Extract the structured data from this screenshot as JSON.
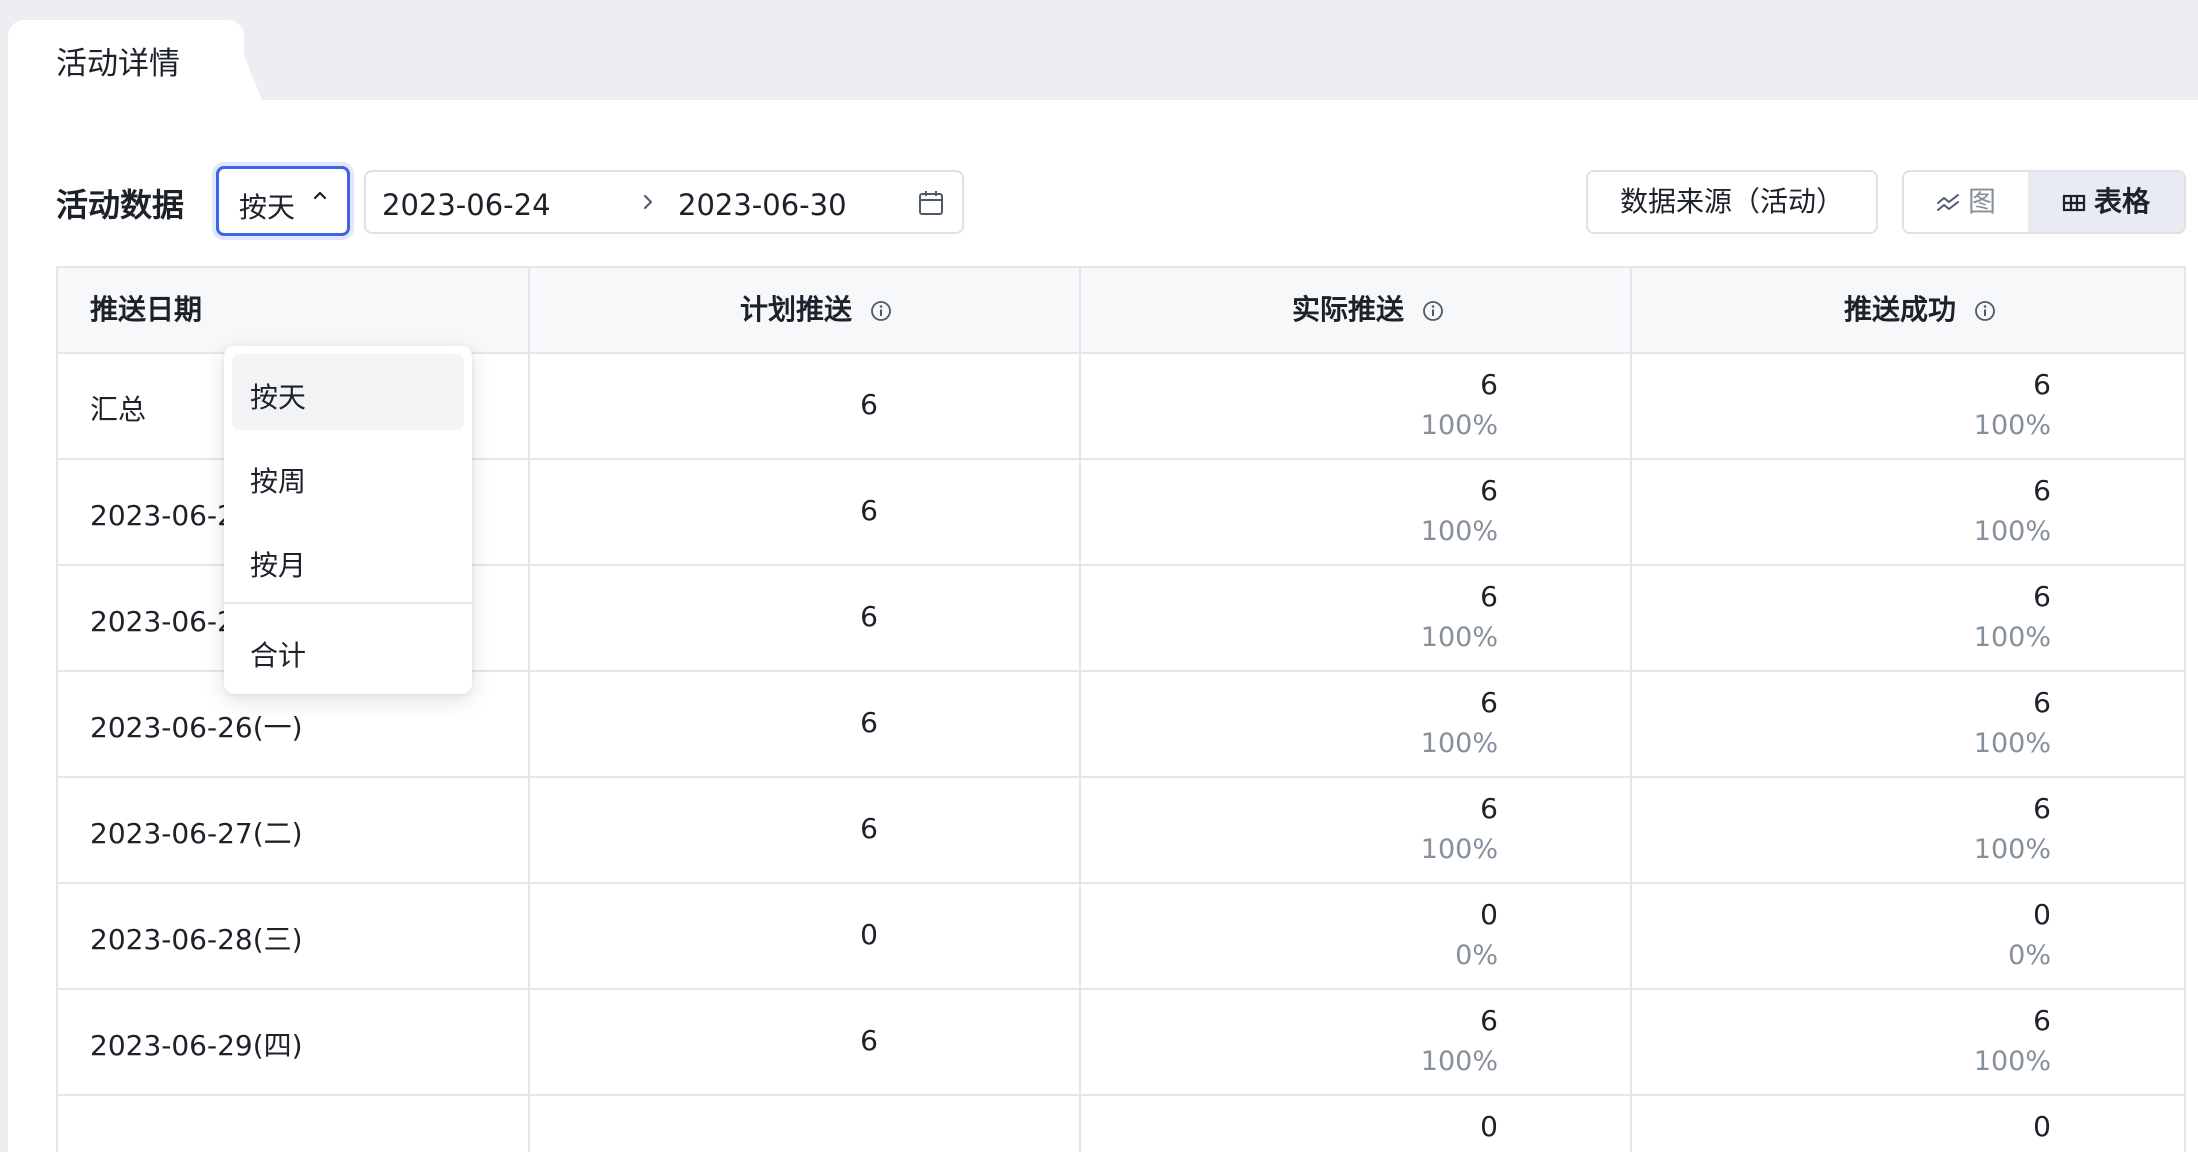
{
  "tab": {
    "title": "活动详情"
  },
  "toolbar": {
    "section_title": "活动数据",
    "period_value": "按天",
    "date_start": "2023-06-24",
    "date_end": "2023-06-30",
    "source_button": "数据来源（活动）",
    "view_chart_label": "图",
    "view_table_label": "表格"
  },
  "dropdown": {
    "items": [
      "按天",
      "按周",
      "按月"
    ],
    "footer_item": "合计",
    "selected": "按天"
  },
  "table": {
    "headers": [
      "推送日期",
      "计划推送",
      "实际推送",
      "推送成功"
    ],
    "rows": [
      {
        "date": "汇总",
        "plan": "6",
        "actual": "6",
        "actual_pct": "100%",
        "success": "6",
        "success_pct": "100%"
      },
      {
        "date": "2023-06-24(六)",
        "plan": "6",
        "actual": "6",
        "actual_pct": "100%",
        "success": "6",
        "success_pct": "100%"
      },
      {
        "date": "2023-06-25(日)",
        "plan": "6",
        "actual": "6",
        "actual_pct": "100%",
        "success": "6",
        "success_pct": "100%"
      },
      {
        "date": "2023-06-26(一)",
        "plan": "6",
        "actual": "6",
        "actual_pct": "100%",
        "success": "6",
        "success_pct": "100%"
      },
      {
        "date": "2023-06-27(二)",
        "plan": "6",
        "actual": "6",
        "actual_pct": "100%",
        "success": "6",
        "success_pct": "100%"
      },
      {
        "date": "2023-06-28(三)",
        "plan": "0",
        "actual": "0",
        "actual_pct": "0%",
        "success": "0",
        "success_pct": "0%"
      },
      {
        "date": "2023-06-29(四)",
        "plan": "6",
        "actual": "6",
        "actual_pct": "100%",
        "success": "6",
        "success_pct": "100%"
      },
      {
        "date": "",
        "plan": "",
        "actual": "0",
        "actual_pct": "",
        "success": "0",
        "success_pct": ""
      }
    ]
  },
  "colors": {
    "accent": "#3f63e6",
    "muted": "#86909c",
    "border": "#e5e6eb",
    "header_bg": "#f7f8fa"
  }
}
